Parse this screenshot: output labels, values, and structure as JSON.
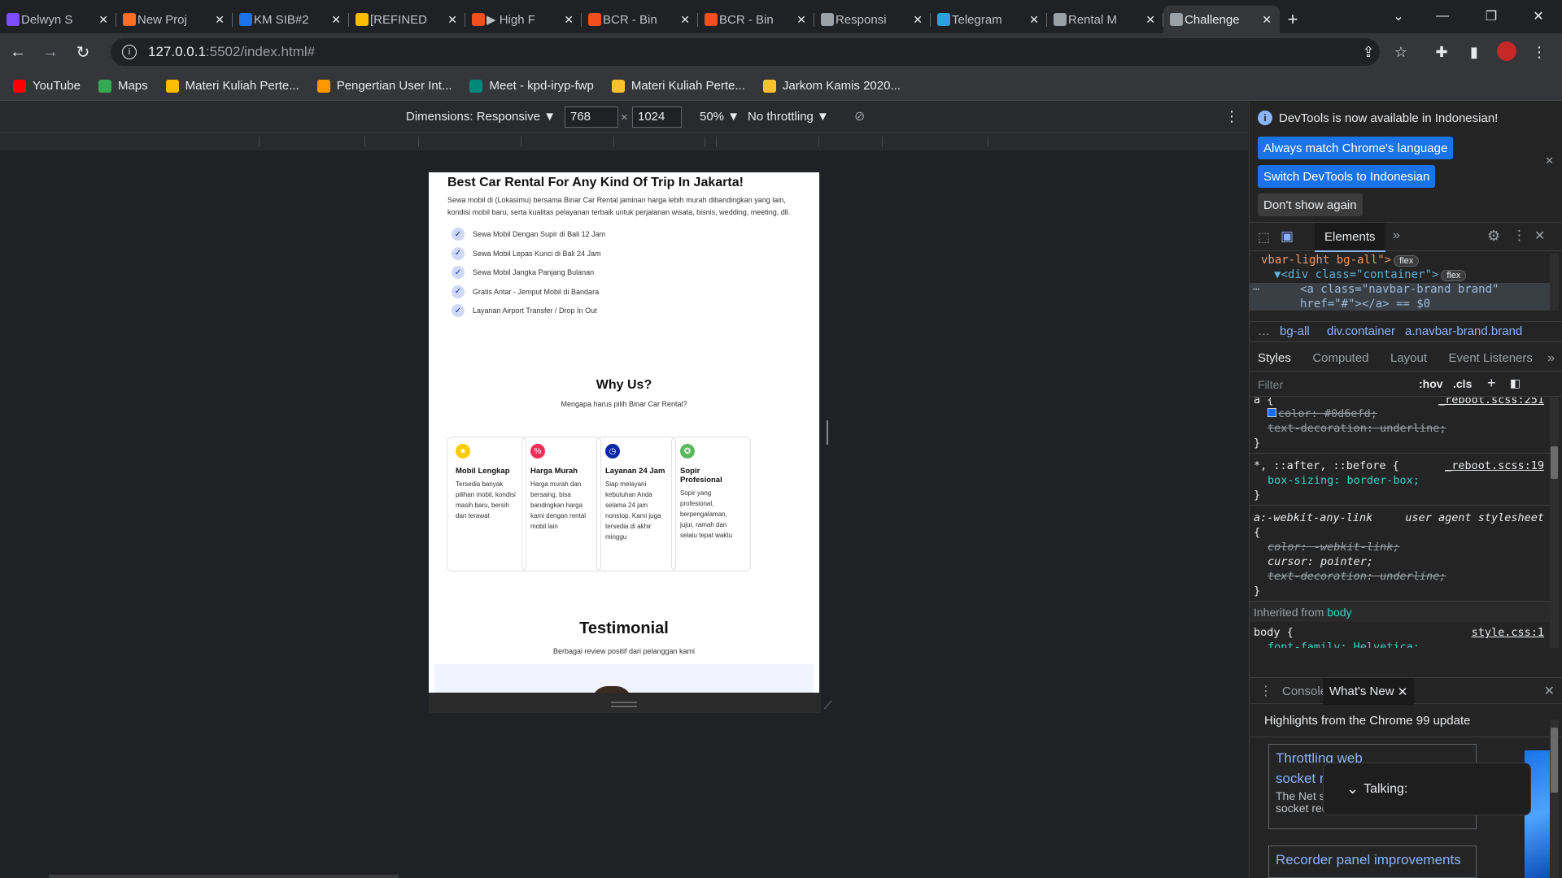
{
  "tabs": [
    {
      "label": "Delwyn S",
      "favicon_color": "#7c4dff",
      "active": false
    },
    {
      "label": "New Proj",
      "favicon_color": "#fc6d26",
      "active": false
    },
    {
      "label": "KM SIB#2",
      "favicon_color": "#1a73e8",
      "active": false
    },
    {
      "label": "[REFINED",
      "favicon_color": "#fbbc04",
      "active": false
    },
    {
      "label": "▶ High F",
      "favicon_color": "#f24e1e",
      "active": false
    },
    {
      "label": "BCR - Bin",
      "favicon_color": "#f24e1e",
      "active": false
    },
    {
      "label": "BCR - Bin",
      "favicon_color": "#f24e1e",
      "active": false
    },
    {
      "label": "Responsi",
      "favicon_color": "#9aa0a6",
      "active": false
    },
    {
      "label": "Telegram",
      "favicon_color": "#2aa1da",
      "active": false
    },
    {
      "label": "Rental M",
      "favicon_color": "#9aa0a6",
      "active": false
    },
    {
      "label": "Challenge",
      "favicon_color": "#9aa0a6",
      "active": true
    }
  ],
  "toolbar": {
    "url_host": "127.0.0.1",
    "url_path": ":5502/index.html#"
  },
  "bookmarks": [
    {
      "label": "YouTube",
      "icon_color": "#ff0000"
    },
    {
      "label": "Maps",
      "icon_color": "#34a853"
    },
    {
      "label": "Materi Kuliah Perte...",
      "icon_color": "#fbbc04"
    },
    {
      "label": "Pengertian User Int...",
      "icon_color": "#ff9800"
    },
    {
      "label": "Meet - kpd-iryp-fwp",
      "icon_color": "#00897b"
    },
    {
      "label": "Materi Kuliah Perte...",
      "icon_color": "#fbc02d"
    },
    {
      "label": "Jarkom Kamis 2020...",
      "icon_color": "#fbc02d"
    }
  ],
  "device_toolbar": {
    "dimensions_label": "Dimensions: Responsive ▼",
    "width": "768",
    "height": "1024",
    "times": "×",
    "zoom": "50% ▼",
    "throttling": "No throttling ▼"
  },
  "page": {
    "heading": "Best Car Rental For Any Kind Of Trip In Jakarta!",
    "lead": "Sewa mobil di (Lokasimu) bersama Binar Car Rental jaminan harga lebih murah dibandingkan yang lain, kondisi mobil baru, serta kualitas pelayanan terbaik untuk perjalanan wisata, bisnis, wedding, meeting, dll.",
    "checklist": [
      "Sewa Mobil Dengan Supir di Bali 12 Jam",
      "Sewa Mobil Lepas Kunci di Bali 24 Jam",
      "Sewa Mobil Jangka Panjang Bulanan",
      "Gratis Antar - Jemput Mobil di Bandara",
      "Layanan Airport Transfer / Drop In Out"
    ],
    "why_title": "Why Us?",
    "why_sub": "Mengapa harus pilih Binar Car Rental?",
    "cards": [
      {
        "title": "Mobil Lengkap",
        "desc": "Tersedia banyak pilihan mobil, kondisi masih baru, bersih dan terawat",
        "icon": "thumbs-up-icon",
        "color": "#f9cc00"
      },
      {
        "title": "Harga Murah",
        "desc": "Harga murah dan bersaing, bisa bandingkan harga kami dengan rental mobil lain",
        "icon": "price-tag-icon",
        "color": "#fa2c5a"
      },
      {
        "title": "Layanan 24 Jam",
        "desc": "Siap melayani kebutuhan Anda selama 24 jam nonstop. Kami juga tersedia di akhir minggu",
        "icon": "clock-icon",
        "color": "#0d28a6"
      },
      {
        "title": "Sopir Profesional",
        "desc": "Sopir yang profesional, berpengalaman, jujur, ramah dan selalu tepat waktu",
        "icon": "award-icon",
        "color": "#5cb85f"
      }
    ],
    "testimonial_title": "Testimonial",
    "testimonial_sub": "Berbagai review positif dari pelanggan kami"
  },
  "devtools": {
    "info": "DevTools is now available in Indonesian!",
    "btn_match": "Always match Chrome's language",
    "btn_switch": "Switch DevTools to Indonesian",
    "btn_dont": "Don't show again",
    "panel_tab": "Elements",
    "dom_lines": [
      "vbar-light bg-all\">",
      "<div class=\"container\">",
      "<a class=\"navbar-brand brand\"",
      "href=\"#\"></a> == $0"
    ],
    "flex": "flex",
    "breadcrumbs": [
      "bg-all",
      "div.container",
      "a.navbar-brand.brand"
    ],
    "style_tabs": [
      "Styles",
      "Computed",
      "Layout",
      "Event Listeners"
    ],
    "filter_placeholder": "Filter",
    "hov": ":hov",
    "cls": ".cls",
    "rule1_src": "_reboot.scss:251",
    "rule1_color": "color: #0d6efd;",
    "rule1_td": "text-decoration: underline;",
    "rule2_sel": "*, ::after, ::before {",
    "rule2_src": "_reboot.scss:19",
    "rule2_prop": "box-sizing: border-box;",
    "rule3_sel": "a:-webkit-any-link",
    "rule3_src": "user agent stylesheet",
    "rule3_color": "color: -webkit-link;",
    "rule3_cursor": "cursor: pointer;",
    "rule3_td": "text-decoration: underline;",
    "inherited": "Inherited from",
    "inherited_el": "body",
    "rule4_sel": "body {",
    "rule4_src": "style.css:1",
    "rule4_prop": "font-family: Helvetica;",
    "drawer_tabs": [
      "Console",
      "What's New"
    ],
    "highlights": "Highlights from the Chrome 99 update",
    "card1_title": "Throttling web socket request",
    "card1_body": "The Net supports throttling web socket requests.",
    "card2_title": "Recorder panel improvements",
    "talking": "Talking:"
  }
}
